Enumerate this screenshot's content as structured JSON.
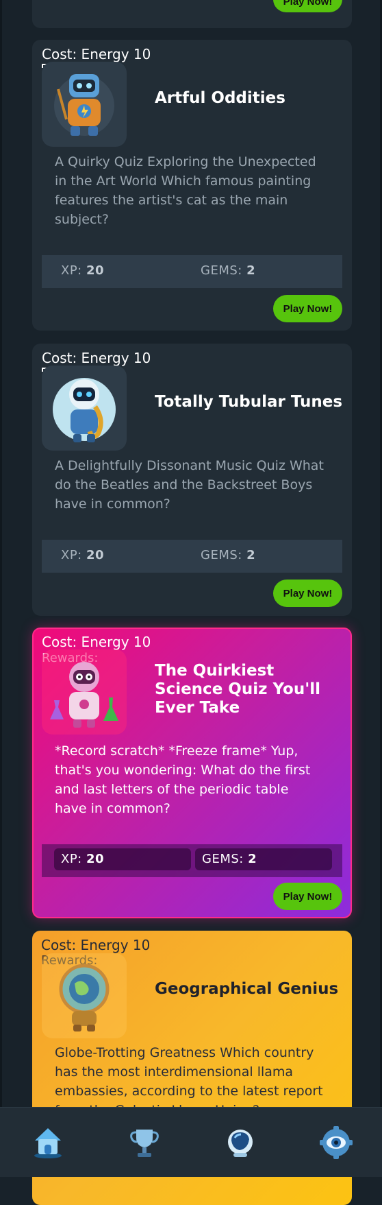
{
  "cards": [
    {
      "play_label": "Play Now!"
    },
    {
      "cost": "Cost: Energy 10",
      "title": "Artful Oddities",
      "description": "A Quirky Quiz Exploring the Unexpected in the Art World Which famous painting features the artist's cat as the main subject?",
      "xp_label": "XP:",
      "xp_value": "20",
      "gems_label": "GEMS:",
      "gems_value": "2",
      "play_label": "Play Now!",
      "avatar_icon": "robot-painter-icon"
    },
    {
      "cost": "Cost: Energy 10",
      "title": "Totally Tubular Tunes",
      "description": "A Delightfully Dissonant Music Quiz What do the Beatles and the Backstreet Boys have in common?",
      "xp_label": "XP:",
      "xp_value": "20",
      "gems_label": "GEMS:",
      "gems_value": "2",
      "play_label": "Play Now!",
      "avatar_icon": "robot-saxophone-icon"
    },
    {
      "cost": "Cost: Energy 10",
      "rewards": "Rewards:",
      "title": "The Quirkiest Science Quiz You'll Ever Take",
      "description": "*Record scratch* *Freeze frame* Yup, that's you wondering: What do the first and last letters of the periodic table have in common?",
      "xp_label": "XP:",
      "xp_value": "20",
      "gems_label": "GEMS:",
      "gems_value": "2",
      "play_label": "Play Now!",
      "avatar_icon": "robot-scientist-icon"
    },
    {
      "cost": "Cost: Energy 10",
      "rewards": "Rewards:",
      "title": "Geographical Genius",
      "description": "Globe-Trotting Greatness Which country has the most interdimensional llama embassies, according to the latest report from the Galactic Llama Union?",
      "avatar_icon": "robot-globe-icon"
    }
  ],
  "nav": [
    {
      "icon": "home-icon"
    },
    {
      "icon": "trophy-icon"
    },
    {
      "icon": "astronaut-helmet-icon"
    },
    {
      "icon": "gear-eye-icon"
    }
  ],
  "colors": {
    "background": "#18222a",
    "card": "#222d36",
    "play_button": "#57c40d",
    "science_gradient_start": "#f10a78",
    "science_gradient_end": "#8c2cdc",
    "geo_gradient_start": "#f59f2a",
    "geo_gradient_end": "#fcc312"
  }
}
